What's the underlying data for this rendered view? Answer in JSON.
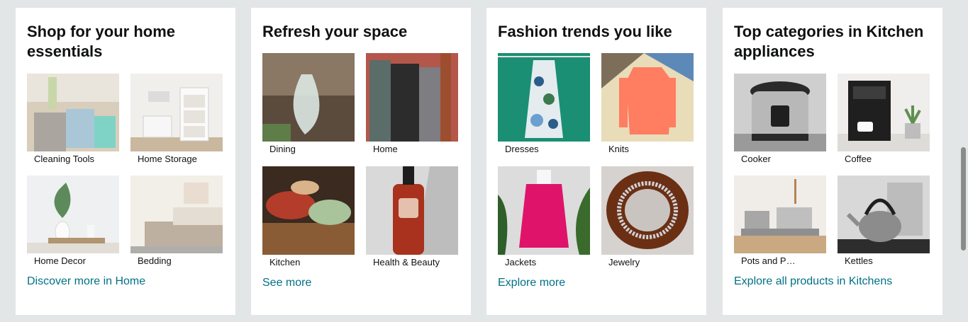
{
  "cards": [
    {
      "title": "Shop for your home essentials",
      "tiles": [
        "Cleaning Tools",
        "Home Storage",
        "Home Decor",
        "Bedding"
      ],
      "link": "Discover more in Home"
    },
    {
      "title": "Refresh your space",
      "tiles": [
        "Dining",
        "Home",
        "Kitchen",
        "Health & Beauty"
      ],
      "link": "See more"
    },
    {
      "title": "Fashion trends you like",
      "tiles": [
        "Dresses",
        "Knits",
        "Jackets",
        "Jewelry"
      ],
      "link": "Explore more"
    },
    {
      "title": "Top categories in Kitchen appliances",
      "tiles": [
        "Cooker",
        "Coffee",
        "Pots and P…",
        "Kettles"
      ],
      "link": "Explore all products in Kitchens"
    }
  ],
  "colors": {
    "page_background": "#e3e6e6",
    "card_background": "#ffffff",
    "link": "#007185",
    "text": "#0f1111"
  }
}
